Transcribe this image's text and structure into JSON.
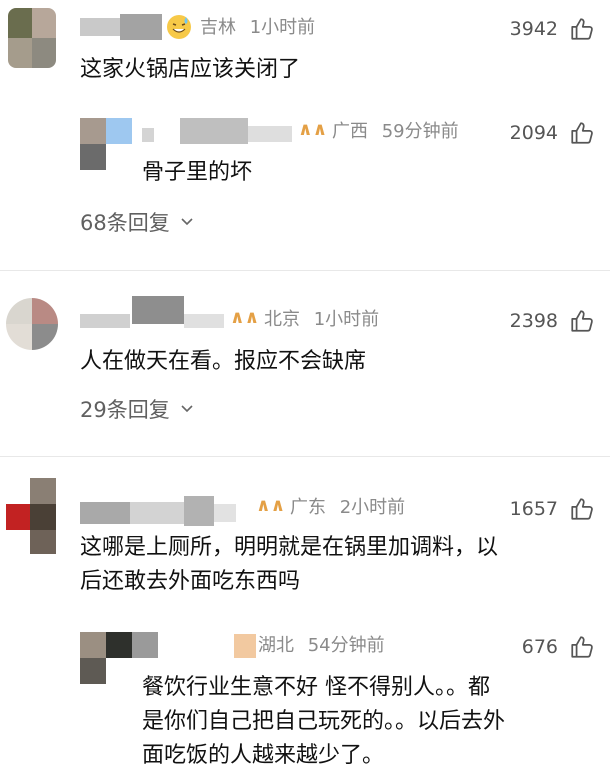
{
  "comments": [
    {
      "location": "吉林",
      "time": "1小时前",
      "likes": "3942",
      "text": "这家火锅店应该关闭了",
      "replies_label": "68条回复",
      "reply": {
        "location": "广西",
        "time": "59分钟前",
        "likes": "2094",
        "text": "骨子里的坏"
      }
    },
    {
      "location": "北京",
      "time": "1小时前",
      "likes": "2398",
      "text": "人在做天在看。报应不会缺席",
      "replies_label": "29条回复"
    },
    {
      "location": "广东",
      "time": "2小时前",
      "likes": "1657",
      "text_line1": "这哪是上厕所，明明就是在锅里加调料，以",
      "text_line2": "后还敢去外面吃东西吗",
      "reply": {
        "location": "湖北",
        "time": "54分钟前",
        "likes": "676",
        "text_line1": "餐饮行业生意不好 怪不得别人。。都",
        "text_line2": "是你们自己把自己玩死的。。以后去外",
        "text_line3": "面吃饭的人越来越少了。"
      }
    }
  ],
  "icons": {
    "like": "thumbs-up-icon",
    "vip": "vip-badge-icon",
    "chevron": "chevron-down-icon",
    "emoji": "sweat-smile-emoji"
  },
  "colors": {
    "meta": "#8a8a8a",
    "text": "#111111",
    "vip": "#e4a045"
  }
}
